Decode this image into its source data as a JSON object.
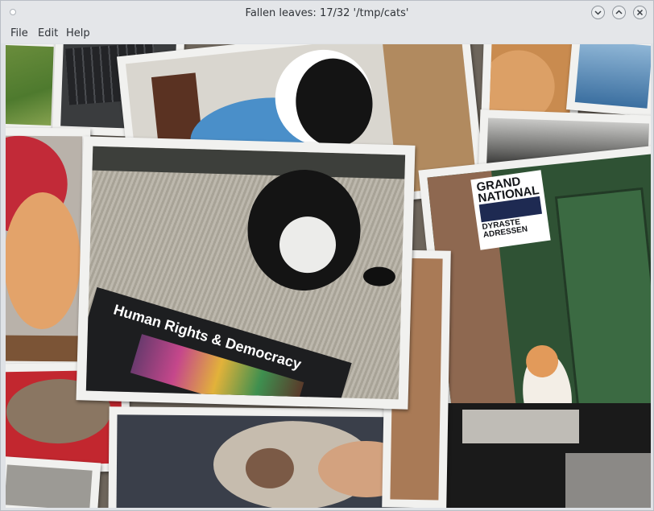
{
  "window": {
    "title": "Fallen leaves: 17/32 '/tmp/cats'",
    "buttons": {
      "minimize": "minimize",
      "maximize": "maximize",
      "close": "close"
    }
  },
  "menu": [
    {
      "label": "File"
    },
    {
      "label": "Edit"
    },
    {
      "label": "Help"
    }
  ],
  "photos": {
    "book_cover_text": "Human Rights & Democracy",
    "poster_text_main": "GRAND NATIONAL",
    "poster_text_sub": "DYRASTE ADRESSEN"
  },
  "colors": {
    "titlebar": "#e4e6e9",
    "photo_border": "#f1f1ef",
    "canvas": "#6d655b"
  }
}
